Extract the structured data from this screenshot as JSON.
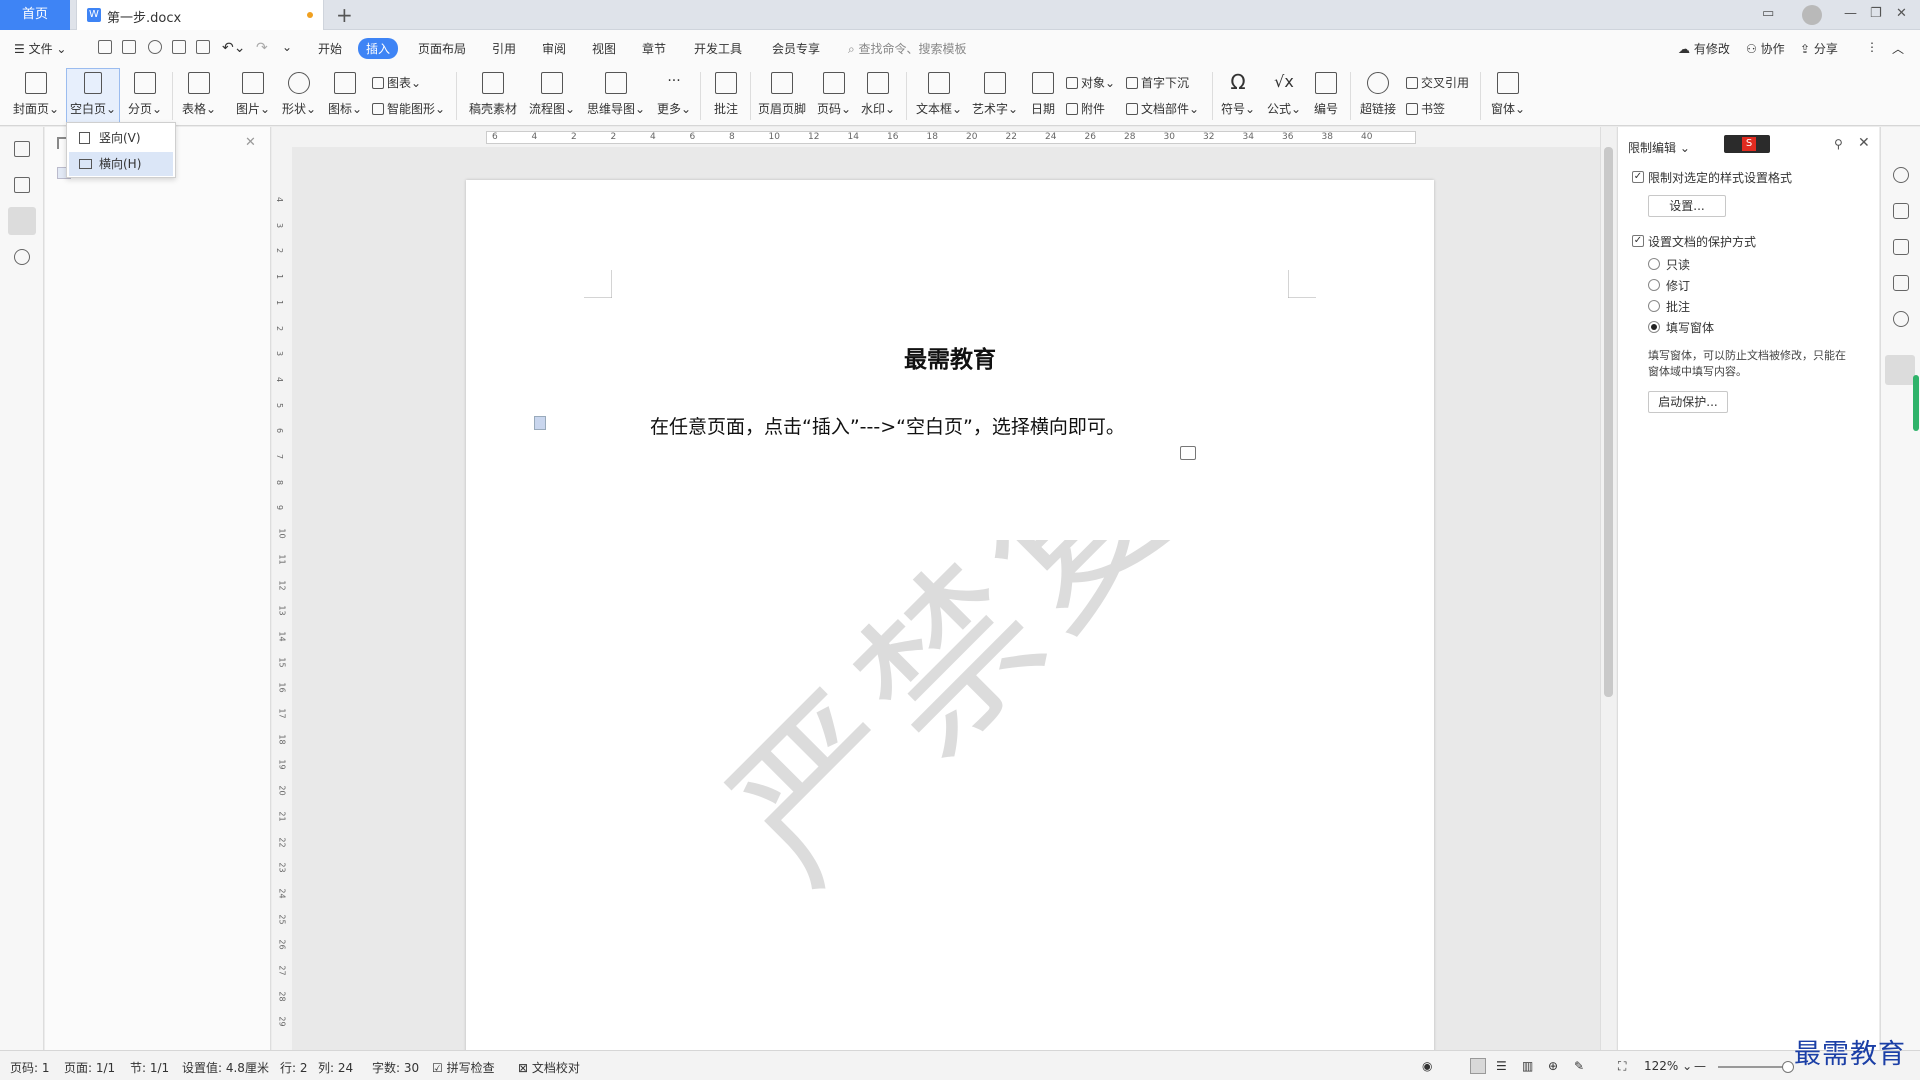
{
  "tabs": {
    "home": "首页",
    "doc": "第一步.docx"
  },
  "menu": {
    "file": "文件",
    "items": [
      "开始",
      "插入",
      "页面布局",
      "引用",
      "审阅",
      "视图",
      "章节",
      "开发工具",
      "会员专享"
    ],
    "active": "插入",
    "search_placeholder": "查找命令、搜索模板",
    "right": {
      "changes": "有修改",
      "collab": "协作",
      "share": "分享"
    }
  },
  "ribbon": {
    "cover": "封面页",
    "blank": "空白页",
    "break": "分页",
    "table": "表格",
    "picture": "图片",
    "shape": "形状",
    "icon": "图标",
    "chart": "图表",
    "smartart": "智能图形",
    "material": "稿壳素材",
    "flow": "流程图",
    "mind": "思维导图",
    "more": "更多",
    "comment": "批注",
    "header_footer": "页眉页脚",
    "page_num": "页码",
    "watermark": "水印",
    "textbox": "文本框",
    "wordart": "艺术字",
    "date": "日期",
    "object": "对象",
    "attachment": "附件",
    "dropcap": "首字下沉",
    "docpart": "文档部件",
    "symbol": "符号",
    "formula": "公式",
    "numbering": "编号",
    "hyperlink": "超链接",
    "crossref": "交叉引用",
    "bookmark": "书签",
    "form": "窗体"
  },
  "dropdown": {
    "portrait": "竖向(V)",
    "landscape": "横向(H)"
  },
  "ruler": {
    "h_ticks": [
      "6",
      "4",
      "2",
      "2",
      "4",
      "6",
      "8",
      "10",
      "12",
      "14",
      "16",
      "18",
      "20",
      "22",
      "24",
      "26",
      "28",
      "30",
      "32",
      "34",
      "36",
      "38",
      "40"
    ],
    "v_ticks": [
      "4",
      "3",
      "2",
      "1",
      "1",
      "2",
      "3",
      "4",
      "5",
      "6",
      "7",
      "8",
      "9",
      "10",
      "11",
      "12",
      "13",
      "14",
      "15",
      "16",
      "17",
      "18",
      "19",
      "20",
      "21",
      "22",
      "23",
      "24",
      "25",
      "26",
      "27",
      "28",
      "29"
    ]
  },
  "document": {
    "title": "最需教育",
    "body": "在任意页面，点击“插入”--->“空白页”，选择横向即可。",
    "watermark": "严禁复制"
  },
  "panel": {
    "title": "限制编辑",
    "opt1": "限制对选定的样式设置格式",
    "settings_btn": "设置...",
    "opt2": "设置文档的保护方式",
    "radios": [
      "只读",
      "修订",
      "批注",
      "填写窗体"
    ],
    "selected": "填写窗体",
    "desc_line1": "填写窗体，可以防止文档被修改，只能在",
    "desc_line2": "窗体域中填写内容。",
    "start_btn": "启动保护..."
  },
  "status": {
    "page": "页码: 1",
    "pages": "页面: 1/1",
    "section": "节: 1/1",
    "setting": "设置值: 4.8厘米",
    "row": "行: 2",
    "col": "列: 24",
    "words": "字数: 30",
    "spell": "拼写检查",
    "proof": "文档校对",
    "zoom": "122%"
  },
  "brand": "最需教育",
  "colors": {
    "accent": "#3e84f5",
    "brand_text": "#1b3fa6",
    "watermark": "#dcdcdc"
  }
}
